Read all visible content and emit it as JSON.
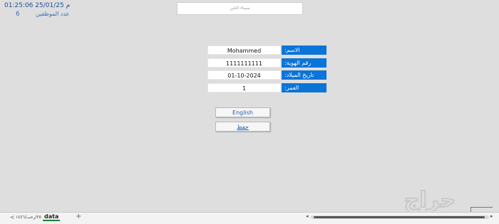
{
  "header": {
    "datetime": "01:25:06 25/01/25 م",
    "employees_label": "عدد الموظفين",
    "employees_count": "6",
    "greeting": "مساء الخير"
  },
  "form": {
    "name_label": "الاسم:",
    "name_value": "Mohammed",
    "id_label": "رقم الهوية:",
    "id_value": "1111111111",
    "dob_label": "تاريخ الميلاد:",
    "dob_value": "01-10-2024",
    "age_label": "العمر:",
    "age_value": "1"
  },
  "buttons": {
    "english": "English",
    "second": "حفظ"
  },
  "sheets": {
    "active": "data",
    "other": "٢٥/رجب/١٤٤٦",
    "add": "+"
  },
  "watermark": {
    "text": "حراج",
    "color": "#c9c9c9"
  }
}
